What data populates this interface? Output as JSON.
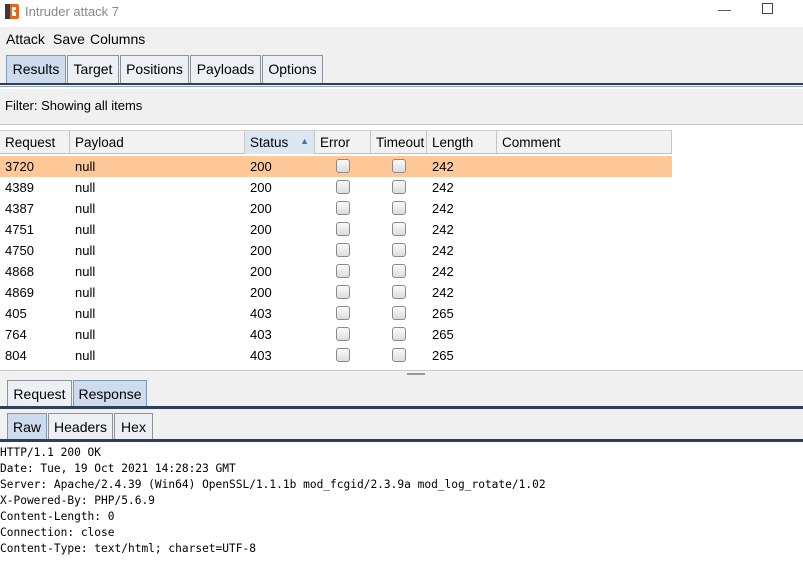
{
  "window": {
    "title": "Intruder attack 7",
    "minimize_glyph": "—",
    "logo_color": "#e8641b"
  },
  "menu": [
    "Attack",
    "Save",
    "Columns"
  ],
  "main_tabs": [
    "Results",
    "Target",
    "Positions",
    "Payloads",
    "Options"
  ],
  "filter": "Filter: Showing all items",
  "table": {
    "columns": [
      "Request",
      "Payload",
      "Status",
      "Error",
      "Timeout",
      "Length",
      "Comment"
    ],
    "sort_indicator": "▲",
    "rows": [
      {
        "request": "3720",
        "payload": "null",
        "status": "200",
        "length": "242",
        "comment": ""
      },
      {
        "request": "4389",
        "payload": "null",
        "status": "200",
        "length": "242",
        "comment": ""
      },
      {
        "request": "4387",
        "payload": "null",
        "status": "200",
        "length": "242",
        "comment": ""
      },
      {
        "request": "4751",
        "payload": "null",
        "status": "200",
        "length": "242",
        "comment": ""
      },
      {
        "request": "4750",
        "payload": "null",
        "status": "200",
        "length": "242",
        "comment": ""
      },
      {
        "request": "4868",
        "payload": "null",
        "status": "200",
        "length": "242",
        "comment": ""
      },
      {
        "request": "4869",
        "payload": "null",
        "status": "200",
        "length": "242",
        "comment": ""
      },
      {
        "request": "405",
        "payload": "null",
        "status": "403",
        "length": "265",
        "comment": ""
      },
      {
        "request": "764",
        "payload": "null",
        "status": "403",
        "length": "265",
        "comment": ""
      },
      {
        "request": "804",
        "payload": "null",
        "status": "403",
        "length": "265",
        "comment": ""
      }
    ]
  },
  "detail_tabs": [
    "Request",
    "Response"
  ],
  "view_tabs": [
    "Raw",
    "Headers",
    "Hex"
  ],
  "response_raw": [
    "HTTP/1.1 200 OK",
    "Date: Tue, 19 Oct 2021 14:28:23 GMT",
    "Server: Apache/2.4.39 (Win64) OpenSSL/1.1.1b mod_fcgid/2.3.9a mod_log_rotate/1.02",
    "X-Powered-By: PHP/5.6.9",
    "Content-Length: 0",
    "Connection: close",
    "Content-Type: text/html; charset=UTF-8"
  ],
  "colors": {
    "selected_row": "#ffc899",
    "active_tab": "#ccdcec",
    "tab_underline": "#2f3f59"
  }
}
